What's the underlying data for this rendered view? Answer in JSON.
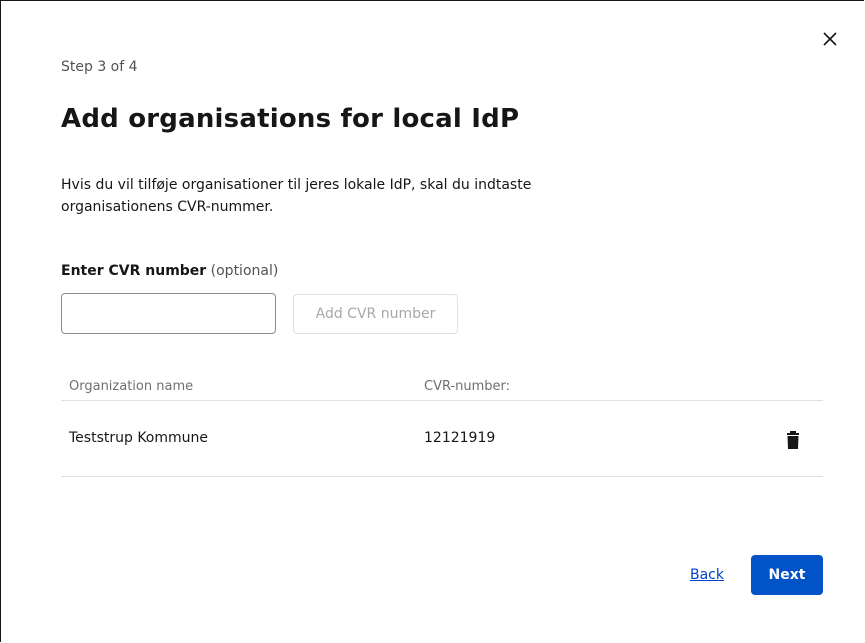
{
  "dialog": {
    "step": "Step 3 of 4",
    "title": "Add organisations for local IdP",
    "description": "Hvis du vil tilføje organisationer til jeres lokale IdP, skal du indtaste organisationens CVR-nummer."
  },
  "form": {
    "label": "Enter CVR number",
    "label_optional": "(optional)",
    "input_value": "",
    "add_button": "Add CVR number"
  },
  "table": {
    "columns": [
      "Organization name",
      "CVR-number:"
    ],
    "rows": [
      {
        "name": "Teststrup Kommune",
        "cvr": "12121919"
      }
    ]
  },
  "footer": {
    "back_label": "Back",
    "next_label": "Next"
  },
  "icons": {
    "close": "close-icon",
    "delete": "trash-icon"
  },
  "colors": {
    "primary": "#0353c8",
    "link": "#0043ce",
    "border": "#e0e0e0"
  }
}
